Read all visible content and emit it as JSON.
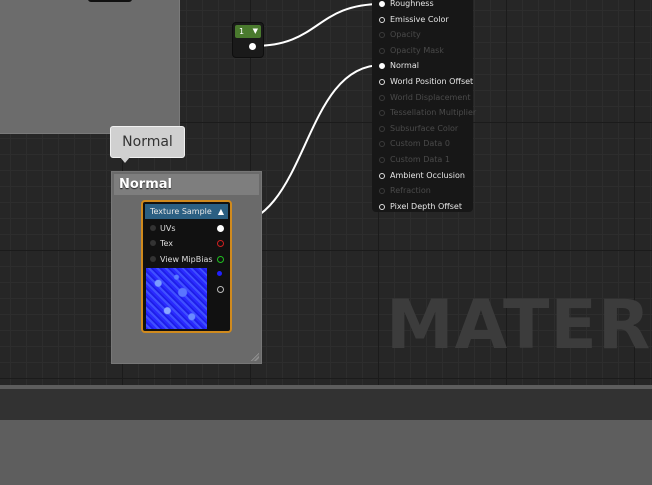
{
  "constant_node": {
    "value": "1"
  },
  "material_node": {
    "inputs": [
      {
        "label": "Roughness",
        "enabled": true,
        "connected": true
      },
      {
        "label": "Emissive Color",
        "enabled": true,
        "connected": false
      },
      {
        "label": "Opacity",
        "enabled": false,
        "connected": false
      },
      {
        "label": "Opacity Mask",
        "enabled": false,
        "connected": false
      },
      {
        "label": "Normal",
        "enabled": true,
        "connected": true
      },
      {
        "label": "World Position Offset",
        "enabled": true,
        "connected": false
      },
      {
        "label": "World Displacement",
        "enabled": false,
        "connected": false
      },
      {
        "label": "Tessellation Multiplier",
        "enabled": false,
        "connected": false
      },
      {
        "label": "Subsurface Color",
        "enabled": false,
        "connected": false
      },
      {
        "label": "Custom Data 0",
        "enabled": false,
        "connected": false
      },
      {
        "label": "Custom Data 1",
        "enabled": false,
        "connected": false
      },
      {
        "label": "Ambient Occlusion",
        "enabled": true,
        "connected": false
      },
      {
        "label": "Refraction",
        "enabled": false,
        "connected": false
      },
      {
        "label": "Pixel Depth Offset",
        "enabled": true,
        "connected": false
      }
    ]
  },
  "comment": {
    "bubble_text": "Normal",
    "title": "Normal"
  },
  "texture_sample": {
    "title": "Texture Sample",
    "inputs": [
      "UVs",
      "Tex",
      "View MipBias"
    ],
    "output_pin_colors": [
      "#ffffff",
      "#d02020",
      "#20c020",
      "#2020ff",
      "#bbbbbb"
    ]
  },
  "watermark": "MATERIA",
  "colors": {
    "graph_bg": "#262626",
    "texture_node_border": "#d08a1d",
    "texture_header": "#2b5f82",
    "constant_header": "#4a7a2e",
    "wire": "#ffffff"
  }
}
